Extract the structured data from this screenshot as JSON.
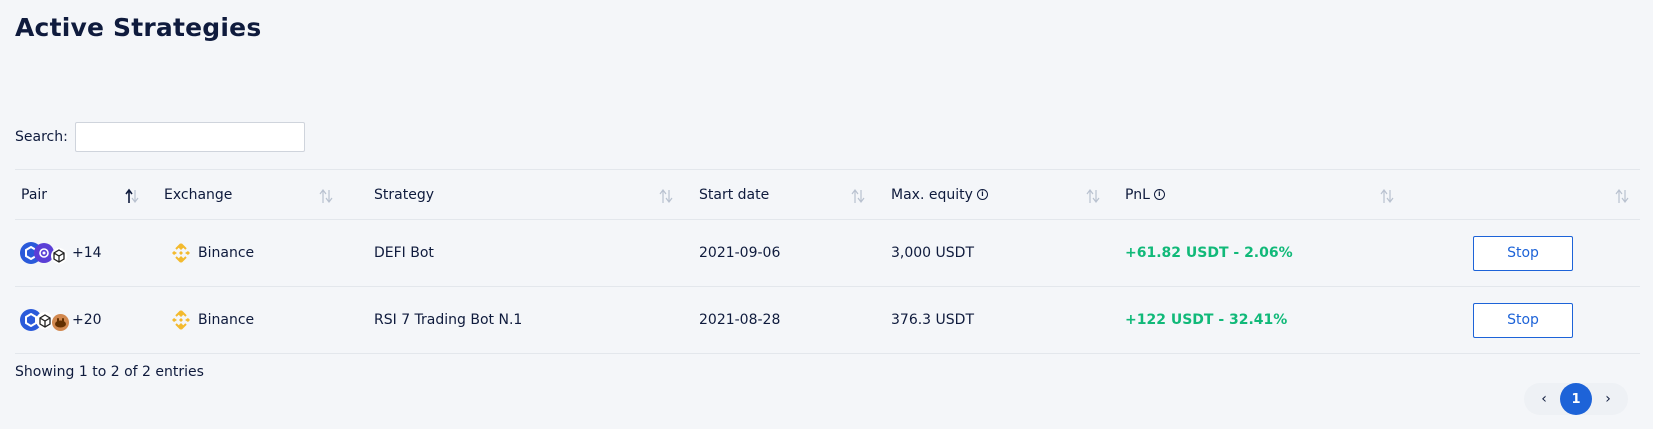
{
  "page": {
    "title": "Active Strategies"
  },
  "search": {
    "label": "Search:",
    "value": "",
    "placeholder": ""
  },
  "table": {
    "headers": {
      "pair": "Pair",
      "exchange": "Exchange",
      "strategy": "Strategy",
      "start_date": "Start date",
      "max_equity": "Max. equity",
      "pnl": "PnL",
      "info_icon": "i"
    },
    "rows": [
      {
        "pair_extra": "+14",
        "coin_icons": [
          "chainlink-icon",
          "polygon-icon",
          "cube-icon"
        ],
        "exchange": "Binance",
        "exchange_icon": "binance-icon",
        "strategy": "DEFI Bot",
        "start_date": "2021-09-06",
        "max_equity": "3,000 USDT",
        "pnl": "+61.82 USDT - 2.06%",
        "action": "Stop"
      },
      {
        "pair_extra": "+20",
        "coin_icons": [
          "chainlink-icon",
          "cube-icon",
          "pancakeswap-icon"
        ],
        "exchange": "Binance",
        "exchange_icon": "binance-icon",
        "strategy": "RSI 7 Trading Bot N.1",
        "start_date": "2021-08-28",
        "max_equity": "376.3 USDT",
        "pnl": "+122 USDT - 32.41%",
        "action": "Stop"
      }
    ]
  },
  "footer": {
    "info": "Showing 1 to 2 of 2 entries",
    "pagination": {
      "prev": "‹",
      "current": "1",
      "next": "›"
    }
  },
  "colors": {
    "accent": "#1d63d8",
    "positive": "#11b979",
    "binance": "#f3ba2f",
    "text": "#0f1b3d"
  }
}
